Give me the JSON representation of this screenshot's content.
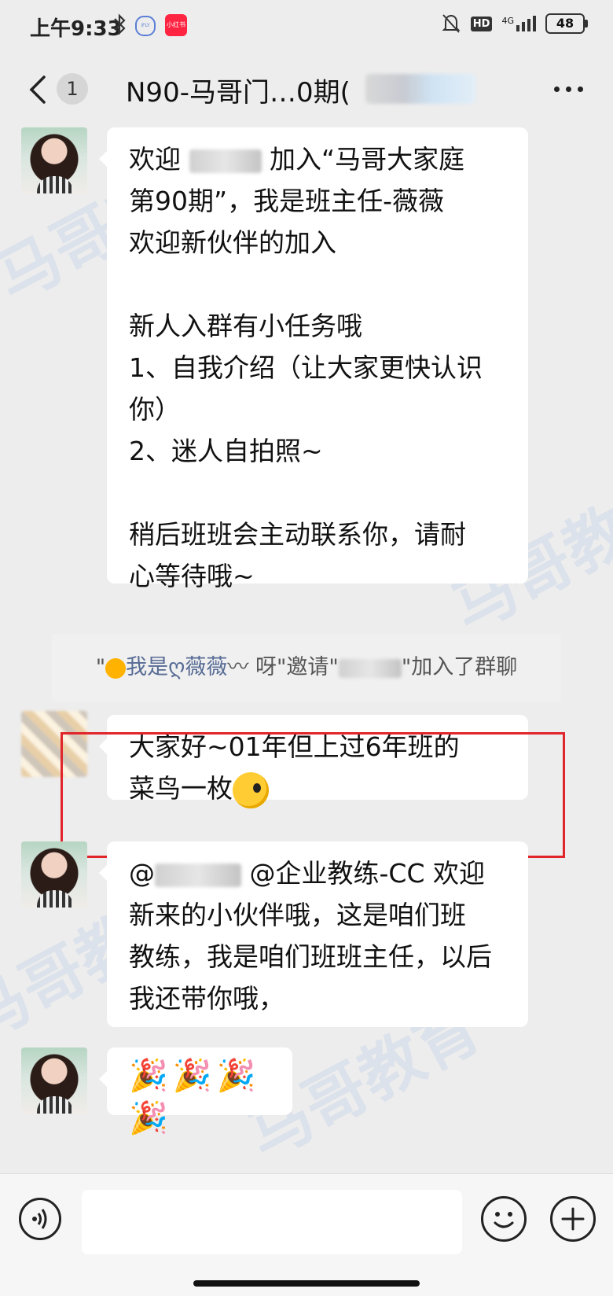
{
  "status_bar": {
    "time": "上午9:33",
    "left_icons": [
      "bluetooth-icon",
      "ifly-app-icon",
      "xiaohongshu-app-icon"
    ],
    "xiaohongshu_label": "小红书",
    "ifly_label": "iFLY",
    "right_icons": [
      "mute-bell-icon",
      "hd-icon",
      "signal-4g-icon"
    ],
    "hd_label": "HD",
    "network_label": "4G",
    "battery": "48"
  },
  "header": {
    "unread_count": "1",
    "title": "N90-马哥门…0期(",
    "back_icon": "chevron-left-icon",
    "more_icon": "more-dots-icon"
  },
  "watermark_text": "马哥教育",
  "messages": [
    {
      "sender_avatar": "avatar-woman-photo",
      "text_prefix": "欢迎 ",
      "text_after_name": " 加入“马哥大家庭\n第90期”，我是班主任-薇薇\n欢迎新伙伴的加入\n\n新人入群有小任务哦\n1、自我介绍（让大家更快认识\n你）\n2、迷人自拍照~\n\n稍后班班会主动联系你，请耐\n心等待哦~"
    },
    {
      "sender_avatar": "avatar-blurred",
      "text": "大家好~01年但上过6年班的\n菜鸟一枚"
    },
    {
      "sender_avatar": "avatar-woman-photo",
      "text_prefix": "@",
      "text_after_name": " @企业教练-CC 欢迎\n新来的小伙伴哦，这是咱们班\n教练，我是咱们班班主任，以后\n我还带你哦，"
    },
    {
      "sender_avatar": "avatar-woman-photo",
      "text": "🎉🎉🎉🎉"
    }
  ],
  "system_note": {
    "part1": "\"",
    "inviter": "我是ღ薇薇",
    "part2": "〰 呀\"邀请\"",
    "part3": "\"加入了群聊"
  },
  "input_bar": {
    "placeholder": "",
    "voice_icon": "voice-icon",
    "emoji_icon": "emoji-smile-icon",
    "plus_icon": "plus-circle-icon"
  },
  "colors": {
    "background": "#ededed",
    "bubble": "#ffffff",
    "highlight_border": "#e0252b"
  }
}
